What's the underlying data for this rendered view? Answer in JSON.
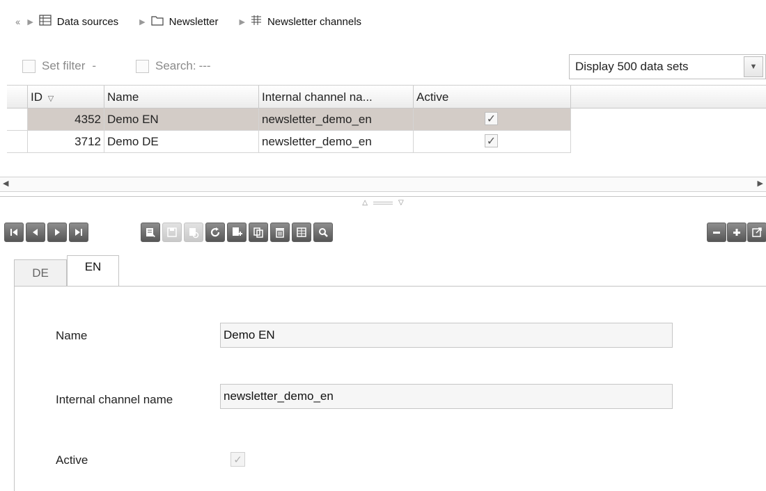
{
  "breadcrumb": {
    "back_icon": "double-chevron-left-icon",
    "items": [
      {
        "label": "Data sources",
        "icon": "table-icon"
      },
      {
        "label": "Newsletter",
        "icon": "folder-icon"
      },
      {
        "label": "Newsletter channels",
        "icon": "table-icon"
      }
    ]
  },
  "filter": {
    "set_filter_label": "Set filter",
    "dash": "-",
    "search_label": "Search:",
    "search_value": "---",
    "display_select_value": "Display 500 data sets"
  },
  "grid": {
    "columns": [
      "ID",
      "Name",
      "Internal channel na...",
      "Active"
    ],
    "sort_indicator": "sort-descending-icon",
    "rows": [
      {
        "id": "4352",
        "name": "Demo EN",
        "internal": "newsletter_demo_en",
        "active": true,
        "selected": true
      },
      {
        "id": "3712",
        "name": "Demo DE",
        "internal": "newsletter_demo_en",
        "active": true,
        "selected": false
      }
    ]
  },
  "toolbar": {
    "nav_buttons": [
      "first-record-icon",
      "previous-record-icon",
      "next-record-icon",
      "last-record-icon"
    ],
    "action_buttons": [
      "edit-icon",
      "save-icon",
      "preview-icon",
      "refresh-icon",
      "new-record-icon",
      "copy-icon",
      "delete-icon",
      "layout-icon",
      "search-icon"
    ],
    "right_buttons": [
      "collapse-icon",
      "expand-icon",
      "external-window-icon"
    ]
  },
  "tabs": [
    "DE",
    "EN"
  ],
  "active_tab": "EN",
  "form": {
    "name_label": "Name",
    "name_value": "Demo EN",
    "internal_label": "Internal channel name",
    "internal_value": "newsletter_demo_en",
    "active_label": "Active",
    "active_checked": true
  },
  "colors": {
    "selected_row": "#d3ccc7",
    "toolbar_button": "#6e6e6e"
  }
}
